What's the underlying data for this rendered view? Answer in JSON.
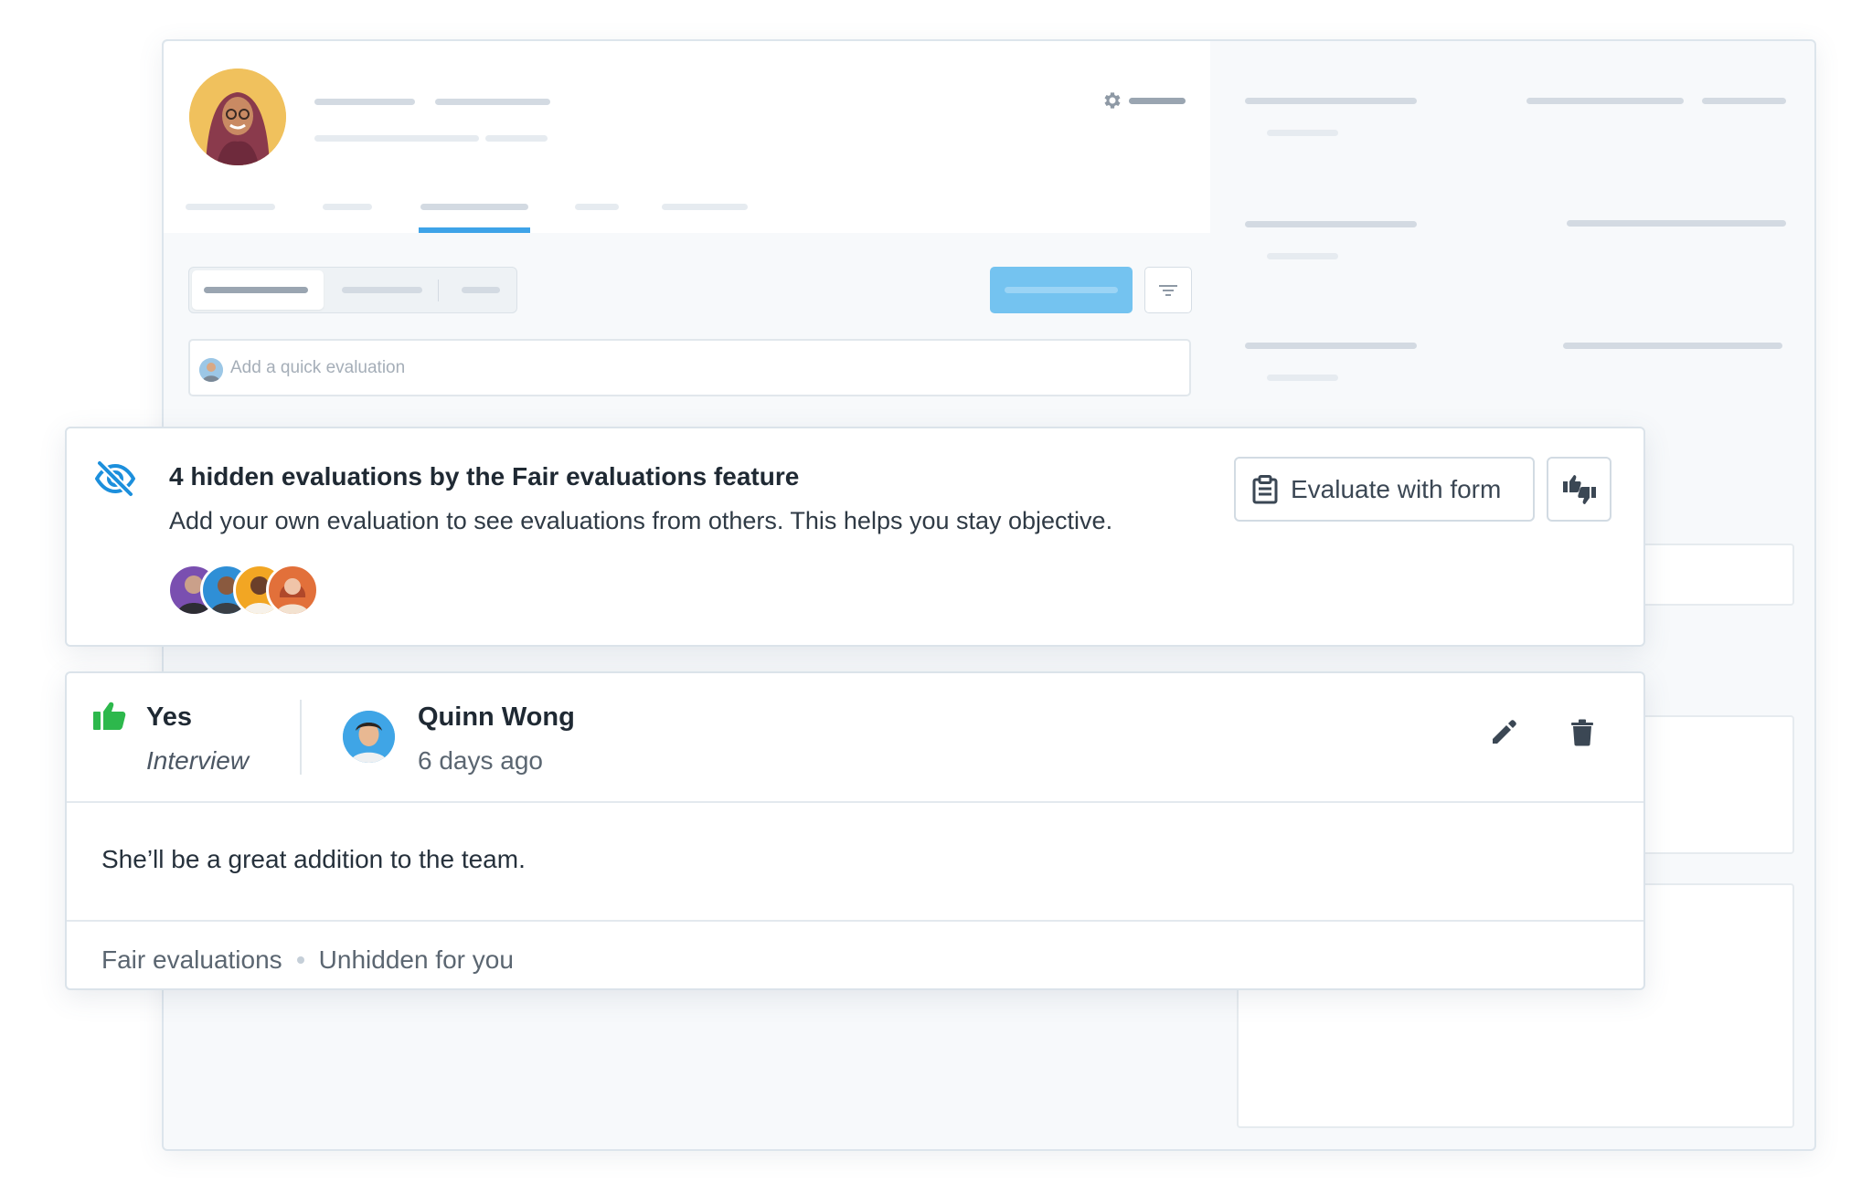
{
  "quick_evaluation": {
    "placeholder": "Add a quick evaluation"
  },
  "hidden_notice": {
    "title": "4 hidden evaluations by the Fair evaluations feature",
    "description": "Add your own evaluation to see evaluations from others. This helps you stay objective.",
    "icon": "eye-off-icon",
    "avatar_colors": [
      "#7a4fb0",
      "#2f8fd6",
      "#f2a623",
      "#e2703a"
    ],
    "evaluate_button_label": "Evaluate with form",
    "accent_color": "#1c8fdc"
  },
  "evaluation": {
    "verdict": "Yes",
    "stage": "Interview",
    "author": "Quinn Wong",
    "time_ago": "6 days ago",
    "comment": "She’ll be a great addition to the team.",
    "footer": {
      "feature": "Fair evaluations",
      "status": "Unhidden for you"
    },
    "verdict_color": "#2db84c"
  }
}
